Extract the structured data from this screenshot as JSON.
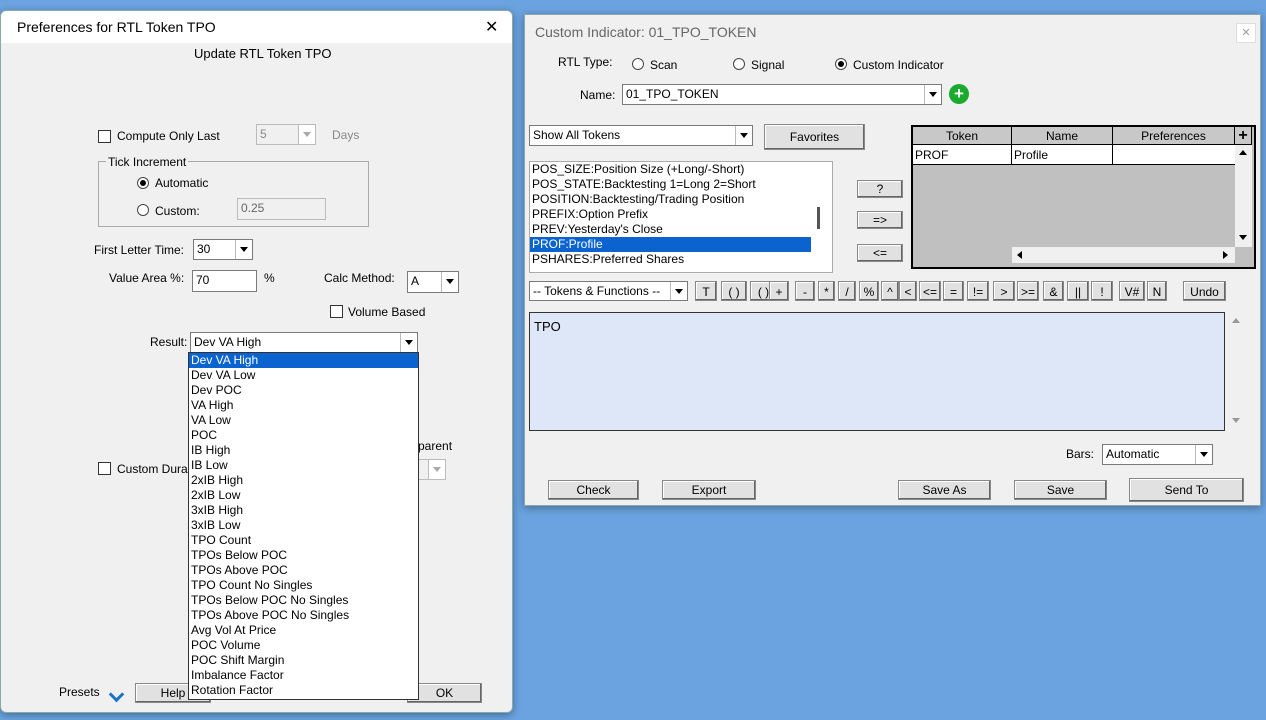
{
  "prefs": {
    "title": "Preferences for RTL Token TPO",
    "close_glyph": "✕",
    "heading": "Update RTL Token TPO",
    "compute_only_last_label": "Compute Only Last",
    "compute_only_last_value": "5",
    "days_label": "Days",
    "tick_increment_label": "Tick Increment",
    "automatic_label": "Automatic",
    "custom_label": "Custom:",
    "custom_value": "0.25",
    "first_letter_time_label": "First Letter Time:",
    "first_letter_time_value": "30",
    "value_area_label": "Value Area %:",
    "value_area_value": "70",
    "percent_sign": "%",
    "calc_method_label": "Calc Method:",
    "calc_method_value": "A",
    "volume_based_label": "Volume Based",
    "result_label": "Result:",
    "result_value": "Dev VA High",
    "result_options": [
      "Dev VA High",
      "Dev VA Low",
      "Dev POC",
      "VA High",
      "VA Low",
      "POC",
      "IB High",
      "IB Low",
      "2xIB High",
      "2xIB Low",
      "3xIB High",
      "3xIB Low",
      "TPO Count",
      "TPOs Below POC",
      "TPOs Above POC",
      "TPO Count No Singles",
      "TPOs Below POC No Singles",
      "TPOs Above POC No Singles",
      "Avg Vol At Price",
      "POC Volume",
      "POC Shift Margin",
      "Imbalance Factor",
      "Rotation Factor"
    ],
    "custom_duration_label": "Custom Dura",
    "transparent_label": "parent",
    "presets_label": "Presets",
    "help_label": "Help",
    "ok_label": "OK"
  },
  "custom": {
    "title": "Custom Indicator: 01_TPO_TOKEN",
    "close_glyph": "✕",
    "rtl_type_label": "RTL Type:",
    "scan_label": "Scan",
    "signal_label": "Signal",
    "custom_indicator_label": "Custom Indicator",
    "name_label": "Name:",
    "name_value": "01_TPO_TOKEN",
    "add_glyph": "+",
    "filter_value": "Show All Tokens",
    "favorites_label": "Favorites",
    "token_list": [
      "POS_SIZE:Position Size (+Long/-Short)",
      "POS_STATE:Backtesting 1=Long 2=Short",
      "POSITION:Backtesting/Trading Position",
      "PREFIX:Option Prefix",
      "PREV:Yesterday's Close",
      "PROF:Profile",
      "PSHARES:Preferred Shares"
    ],
    "help_btn": "?",
    "add_btn": "=>",
    "remove_btn": "<=",
    "grid_headers": [
      "Token",
      "Name",
      "Preferences"
    ],
    "grid_plus": "+",
    "grid_rows": [
      {
        "token": "PROF",
        "name": "Profile",
        "prefs": ""
      }
    ],
    "tokens_functions_value": "-- Tokens & Functions --",
    "operators": [
      "T",
      "( )",
      "( )",
      "+",
      "-",
      "*",
      "/",
      "%",
      "^",
      "<",
      "<=",
      "=",
      "!=",
      ">",
      ">=",
      "&",
      "||",
      "!",
      "V#",
      "N",
      "Undo"
    ],
    "formula": "TPO",
    "bars_label": "Bars:",
    "bars_value": "Automatic",
    "check_label": "Check",
    "export_label": "Export",
    "save_as_label": "Save As",
    "save_label": "Save",
    "send_to_label": "Send To"
  },
  "colors": {
    "desktop": "#6aa3e0",
    "selection": "#0a63cf",
    "formula_bg": "#dde7f8",
    "add_icon": "#1aab2e"
  }
}
